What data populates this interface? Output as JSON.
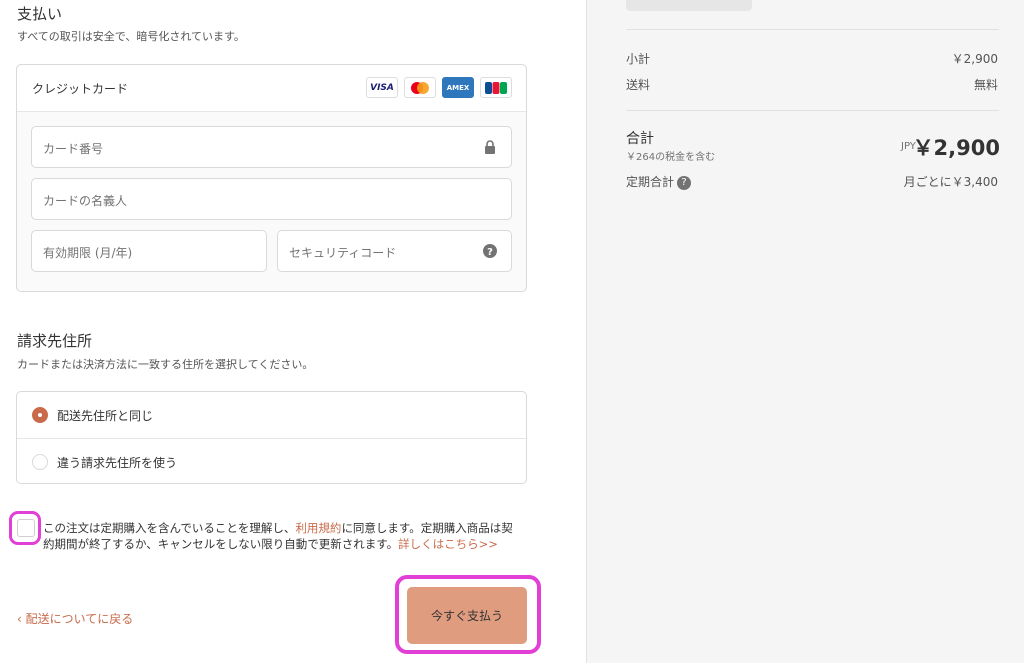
{
  "payment": {
    "title": "支払い",
    "subtitle": "すべての取引は安全で、暗号化されています。",
    "method_label": "クレジットカード",
    "brands": [
      "VISA",
      "AMEX",
      "JCB"
    ],
    "fields": {
      "card_number": "カード番号",
      "card_name": "カードの名義人",
      "expiry": "有効期限 (月/年)",
      "security": "セキュリティコード"
    }
  },
  "billing": {
    "title": "請求先住所",
    "subtitle": "カードまたは決済方法に一致する住所を選択してください。",
    "options": [
      "配送先住所と同じ",
      "違う請求先住所を使う"
    ]
  },
  "agreement": {
    "text_before": "この注文は定期購入を含んでいることを理解し、",
    "terms_link": "利用規約",
    "text_after": "に同意します。定期購入商品は契約期間が終了するか、キャンセルをしない限り自動で更新されます。",
    "more_link": "詳しくはこちら>>"
  },
  "footer": {
    "back_label": "‹ 配送についてに戻る",
    "pay_label": "今すぐ支払う"
  },
  "summary": {
    "subtotal_label": "小計",
    "subtotal_value": "￥2,900",
    "shipping_label": "送料",
    "shipping_value": "無料",
    "total_label": "合計",
    "tax_note": "￥264の税金を含む",
    "currency": "JPY",
    "total_value": "￥2,900",
    "recurring_label": "定期合計",
    "recurring_value": "月ごとに￥3,400"
  },
  "colors": {
    "accent": "#c96b4b",
    "button": "#df9c7f",
    "highlight": "#e23fd6"
  }
}
